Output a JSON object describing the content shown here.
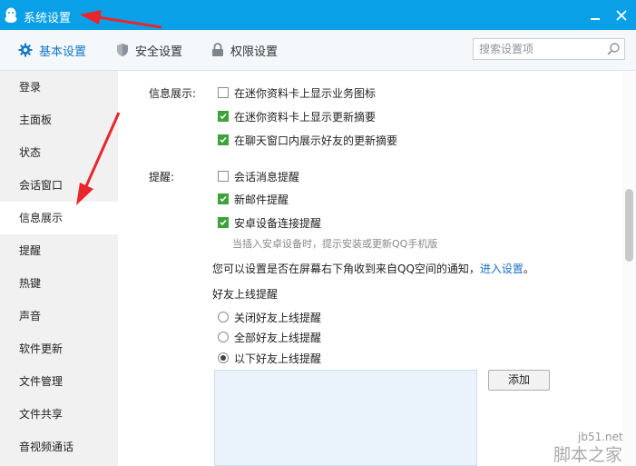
{
  "window": {
    "title": "系统设置"
  },
  "tabs": [
    {
      "label": "基本设置",
      "icon": "gear-icon",
      "active": true
    },
    {
      "label": "安全设置",
      "icon": "shield-icon",
      "active": false
    },
    {
      "label": "权限设置",
      "icon": "lock-icon",
      "active": false
    }
  ],
  "search": {
    "placeholder": "搜索设置项"
  },
  "sidebar": {
    "items": [
      {
        "label": "登录"
      },
      {
        "label": "主面板"
      },
      {
        "label": "状态"
      },
      {
        "label": "会话窗口"
      },
      {
        "label": "信息展示",
        "active": true
      },
      {
        "label": "提醒"
      },
      {
        "label": "热键"
      },
      {
        "label": "声音"
      },
      {
        "label": "软件更新"
      },
      {
        "label": "文件管理"
      },
      {
        "label": "文件共享"
      },
      {
        "label": "音视频通话"
      }
    ]
  },
  "info_display": {
    "label": "信息展示:",
    "options": [
      {
        "label": "在迷你资料卡上显示业务图标",
        "checked": false
      },
      {
        "label": "在迷你资料卡上显示更新摘要",
        "checked": true
      },
      {
        "label": "在聊天窗口内展示好友的更新摘要",
        "checked": true
      }
    ]
  },
  "reminders": {
    "label": "提醒:",
    "options": [
      {
        "label": "会话消息提醒",
        "checked": false
      },
      {
        "label": "新邮件提醒",
        "checked": true
      },
      {
        "label": "安卓设备连接提醒",
        "checked": true
      }
    ],
    "android_hint": "当插入安卓设备时，提示安装或更新QQ手机版",
    "qzone_notice": "您可以设置是否在屏幕右下角收到来自QQ空间的通知，",
    "qzone_link": "进入设置",
    "qzone_suffix": "。"
  },
  "friend_online": {
    "title": "好友上线提醒",
    "options": [
      {
        "label": "关闭好友上线提醒",
        "selected": false
      },
      {
        "label": "全部好友上线提醒",
        "selected": false
      },
      {
        "label": "以下好友上线提醒",
        "selected": true
      }
    ],
    "add_button": "添加"
  },
  "watermark": {
    "url": "jb51.net",
    "site": "脚本之家"
  },
  "colors": {
    "title_bar": "#0aa0e8",
    "accent": "#1577c9",
    "check_green": "#3ca23c",
    "annotation_red": "#e8262c"
  }
}
